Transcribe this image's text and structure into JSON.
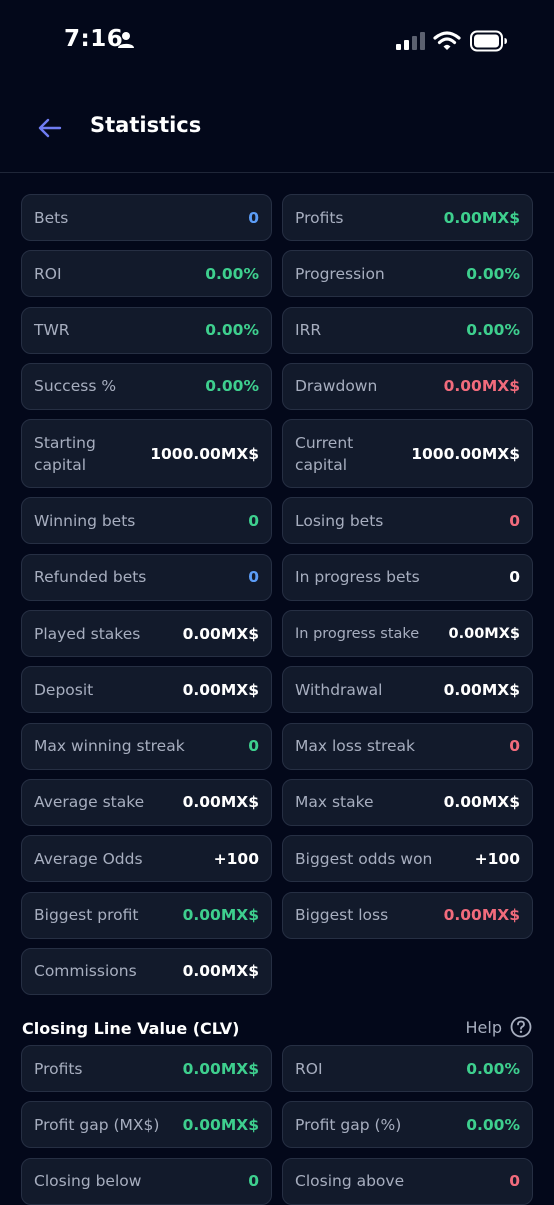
{
  "status_bar": {
    "time": "7:16"
  },
  "header": {
    "title": "Statistics"
  },
  "stats": [
    {
      "label": "Bets",
      "value": "0",
      "color": "blue"
    },
    {
      "label": "Profits",
      "value": "0.00MX$",
      "color": "green"
    },
    {
      "label": "ROI",
      "value": "0.00%",
      "color": "green"
    },
    {
      "label": "Progression",
      "value": "0.00%",
      "color": "green"
    },
    {
      "label": "TWR",
      "value": "0.00%",
      "color": "green"
    },
    {
      "label": "IRR",
      "value": "0.00%",
      "color": "green"
    },
    {
      "label": "Success %",
      "value": "0.00%",
      "color": "green"
    },
    {
      "label": "Drawdown",
      "value": "0.00MX$",
      "color": "red"
    },
    {
      "label": "Starting capital",
      "value": "1000.00MX$",
      "color": "white"
    },
    {
      "label": "Current capital",
      "value": "1000.00MX$",
      "color": "white"
    },
    {
      "label": "Winning bets",
      "value": "0",
      "color": "green"
    },
    {
      "label": "Losing bets",
      "value": "0",
      "color": "red"
    },
    {
      "label": "Refunded bets",
      "value": "0",
      "color": "blue"
    },
    {
      "label": "In progress bets",
      "value": "0",
      "color": "white"
    },
    {
      "label": "Played stakes",
      "value": "0.00MX$",
      "color": "white"
    },
    {
      "label": "In progress stake",
      "value": "0.00MX$",
      "color": "white"
    },
    {
      "label": "Deposit",
      "value": "0.00MX$",
      "color": "white"
    },
    {
      "label": "Withdrawal",
      "value": "0.00MX$",
      "color": "white"
    },
    {
      "label": "Max winning streak",
      "value": "0",
      "color": "green"
    },
    {
      "label": "Max loss streak",
      "value": "0",
      "color": "red"
    },
    {
      "label": "Average stake",
      "value": "0.00MX$",
      "color": "white"
    },
    {
      "label": "Max stake",
      "value": "0.00MX$",
      "color": "white"
    },
    {
      "label": "Average Odds",
      "value": "+100",
      "color": "white"
    },
    {
      "label": "Biggest odds won",
      "value": "+100",
      "color": "white"
    },
    {
      "label": "Biggest profit",
      "value": "0.00MX$",
      "color": "green"
    },
    {
      "label": "Biggest loss",
      "value": "0.00MX$",
      "color": "red"
    },
    {
      "label": "Commissions",
      "value": "0.00MX$",
      "color": "white"
    }
  ],
  "clv": {
    "title": "Closing Line Value (CLV)",
    "help_label": "Help",
    "stats": [
      {
        "label": "Profits",
        "value": "0.00MX$",
        "color": "green"
      },
      {
        "label": "ROI",
        "value": "0.00%",
        "color": "green"
      },
      {
        "label": "Profit gap (MX$)",
        "value": "0.00MX$",
        "color": "green"
      },
      {
        "label": "Profit gap (%)",
        "value": "0.00%",
        "color": "green"
      },
      {
        "label": "Closing below",
        "value": "0",
        "color": "green"
      },
      {
        "label": "Closing above",
        "value": "0",
        "color": "red"
      }
    ]
  },
  "colors": {
    "background": "#03081a",
    "card": "#121a2b",
    "green": "#3ecf8e",
    "red": "#f16b7c",
    "blue": "#5b9cf6",
    "accent": "#6f7cf2"
  },
  "icons": [
    "person-icon",
    "signal-icon",
    "wifi-icon",
    "battery-icon",
    "back-arrow-icon",
    "help-circle-icon"
  ]
}
